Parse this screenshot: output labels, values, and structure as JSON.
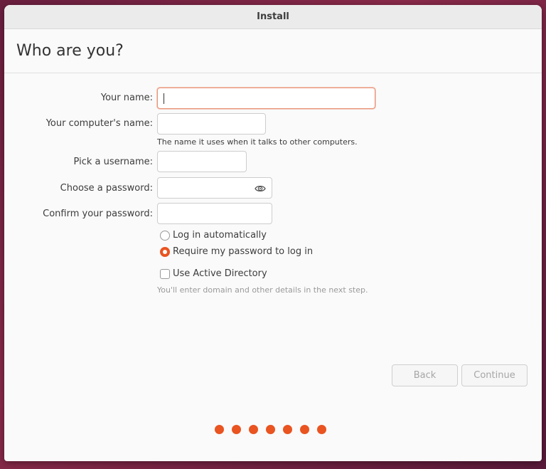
{
  "window": {
    "title": "Install"
  },
  "header": {
    "title": "Who are you?"
  },
  "form": {
    "name_label": "Your name:",
    "name_value": "",
    "computer_label": "Your computer's name:",
    "computer_value": "",
    "computer_hint": "The name it uses when it talks to other computers.",
    "username_label": "Pick a username:",
    "username_value": "",
    "password_label": "Choose a password:",
    "password_value": "",
    "confirm_label": "Confirm your password:",
    "confirm_value": ""
  },
  "options": {
    "auto_login_label": "Log in automatically",
    "auto_login_checked": false,
    "require_password_label": "Require my password to log in",
    "require_password_checked": true,
    "active_directory_label": "Use Active Directory",
    "active_directory_checked": false,
    "active_directory_hint": "You'll enter domain and other details in the next step."
  },
  "buttons": {
    "back": "Back",
    "continue": "Continue"
  },
  "progress": {
    "total_steps": 7
  },
  "colors": {
    "accent": "#e95420",
    "focus_border": "#e9947a"
  },
  "icons": {
    "password_toggle": "eye-icon"
  }
}
